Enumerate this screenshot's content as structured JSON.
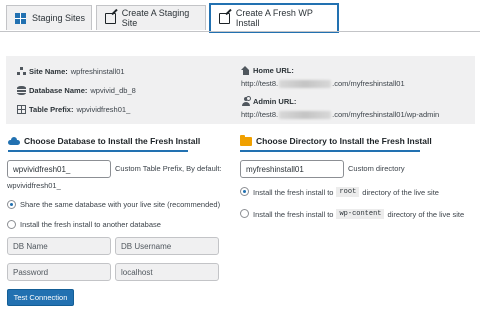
{
  "tabs": [
    {
      "label": "Staging Sites",
      "icon": "grid-icon"
    },
    {
      "label": "Create A Staging Site",
      "icon": "edit-icon"
    },
    {
      "label": "Create A Fresh WP Install",
      "icon": "edit-icon",
      "active": true
    }
  ],
  "info": {
    "site_name_label": "Site Name:",
    "site_name_value": "wpfreshinstall01",
    "database_name_label": "Database Name:",
    "database_name_value": "wpvivid_db_8",
    "table_prefix_label": "Table Prefix:",
    "table_prefix_value": "wpvividfresh01_",
    "home_url_label": "Home URL:",
    "home_url_prefix": "http://test8.",
    "home_url_suffix": ".com/myfreshinstall01",
    "admin_url_label": "Admin URL:",
    "admin_url_prefix": "http://test8.",
    "admin_url_suffix": ".com/myfreshinstall01/wp-admin"
  },
  "database_section": {
    "title": "Choose Database to Install the Fresh Install",
    "table_prefix_value": "wpvividfresh01_",
    "table_prefix_hint": "Custom Table Prefix, By default:",
    "table_prefix_default": "wpvividfresh01_",
    "option_same": "Share the same database with your live site (recommended)",
    "option_other": "Install the fresh install to another database",
    "db_name_placeholder": "DB Name",
    "db_username_placeholder": "DB Username",
    "password_placeholder": "Password",
    "host_value": "localhost",
    "test_button": "Test Connection"
  },
  "directory_section": {
    "title": "Choose Directory to Install the Fresh Install",
    "directory_value": "myfreshinstall01",
    "directory_hint": "Custom directory",
    "option_root_pre": "Install the fresh install to",
    "option_root_code": "root",
    "option_root_post": "directory of the live site",
    "option_content_pre": "Install the fresh install to",
    "option_content_code": "wp-content",
    "option_content_post": "directory of the live site"
  },
  "colors": {
    "accent": "#2271b1",
    "folder": "#f0a000",
    "panel": "#f0f0f1"
  }
}
